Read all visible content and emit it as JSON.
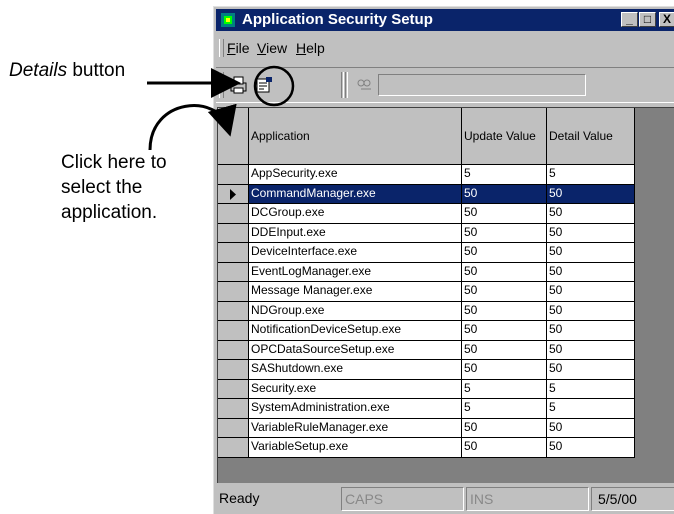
{
  "callouts": {
    "details_emphasis": "Details",
    "details_rest": " button",
    "click_line1": "Click here to",
    "click_line2": "select the",
    "click_line3": "application."
  },
  "window": {
    "title": "Application Security Setup",
    "minimize": "_",
    "maximize": "□",
    "close": "X"
  },
  "menu": [
    {
      "key": "F",
      "rest": "ile"
    },
    {
      "key": "V",
      "rest": "iew"
    },
    {
      "key": "H",
      "rest": "elp"
    }
  ],
  "table": {
    "columns": [
      "Application",
      "Update Value",
      "Detail Value"
    ],
    "rows": [
      {
        "app": "AppSecurity.exe",
        "update": "5",
        "detail": "5"
      },
      {
        "app": "CommandManager.exe",
        "update": "50",
        "detail": "50",
        "selected": true
      },
      {
        "app": "DCGroup.exe",
        "update": "50",
        "detail": "50"
      },
      {
        "app": "DDEInput.exe",
        "update": "50",
        "detail": "50"
      },
      {
        "app": "DeviceInterface.exe",
        "update": "50",
        "detail": "50"
      },
      {
        "app": "EventLogManager.exe",
        "update": "50",
        "detail": "50"
      },
      {
        "app": "Message Manager.exe",
        "update": "50",
        "detail": "50"
      },
      {
        "app": "NDGroup.exe",
        "update": "50",
        "detail": "50"
      },
      {
        "app": "NotificationDeviceSetup.exe",
        "update": "50",
        "detail": "50"
      },
      {
        "app": "OPCDataSourceSetup.exe",
        "update": "50",
        "detail": "50"
      },
      {
        "app": "SAShutdown.exe",
        "update": "50",
        "detail": "50"
      },
      {
        "app": "Security.exe",
        "update": "5",
        "detail": "5"
      },
      {
        "app": "SystemAdministration.exe",
        "update": "5",
        "detail": "5"
      },
      {
        "app": "VariableRuleManager.exe",
        "update": "50",
        "detail": "50"
      },
      {
        "app": "VariableSetup.exe",
        "update": "50",
        "detail": "50"
      }
    ]
  },
  "status": {
    "ready": "Ready",
    "caps": "CAPS",
    "ins": "INS",
    "date": "5/5/00"
  },
  "colors": {
    "titlebar": "#0a246a",
    "selection": "#0a246a",
    "face": "#c0c0c0"
  }
}
